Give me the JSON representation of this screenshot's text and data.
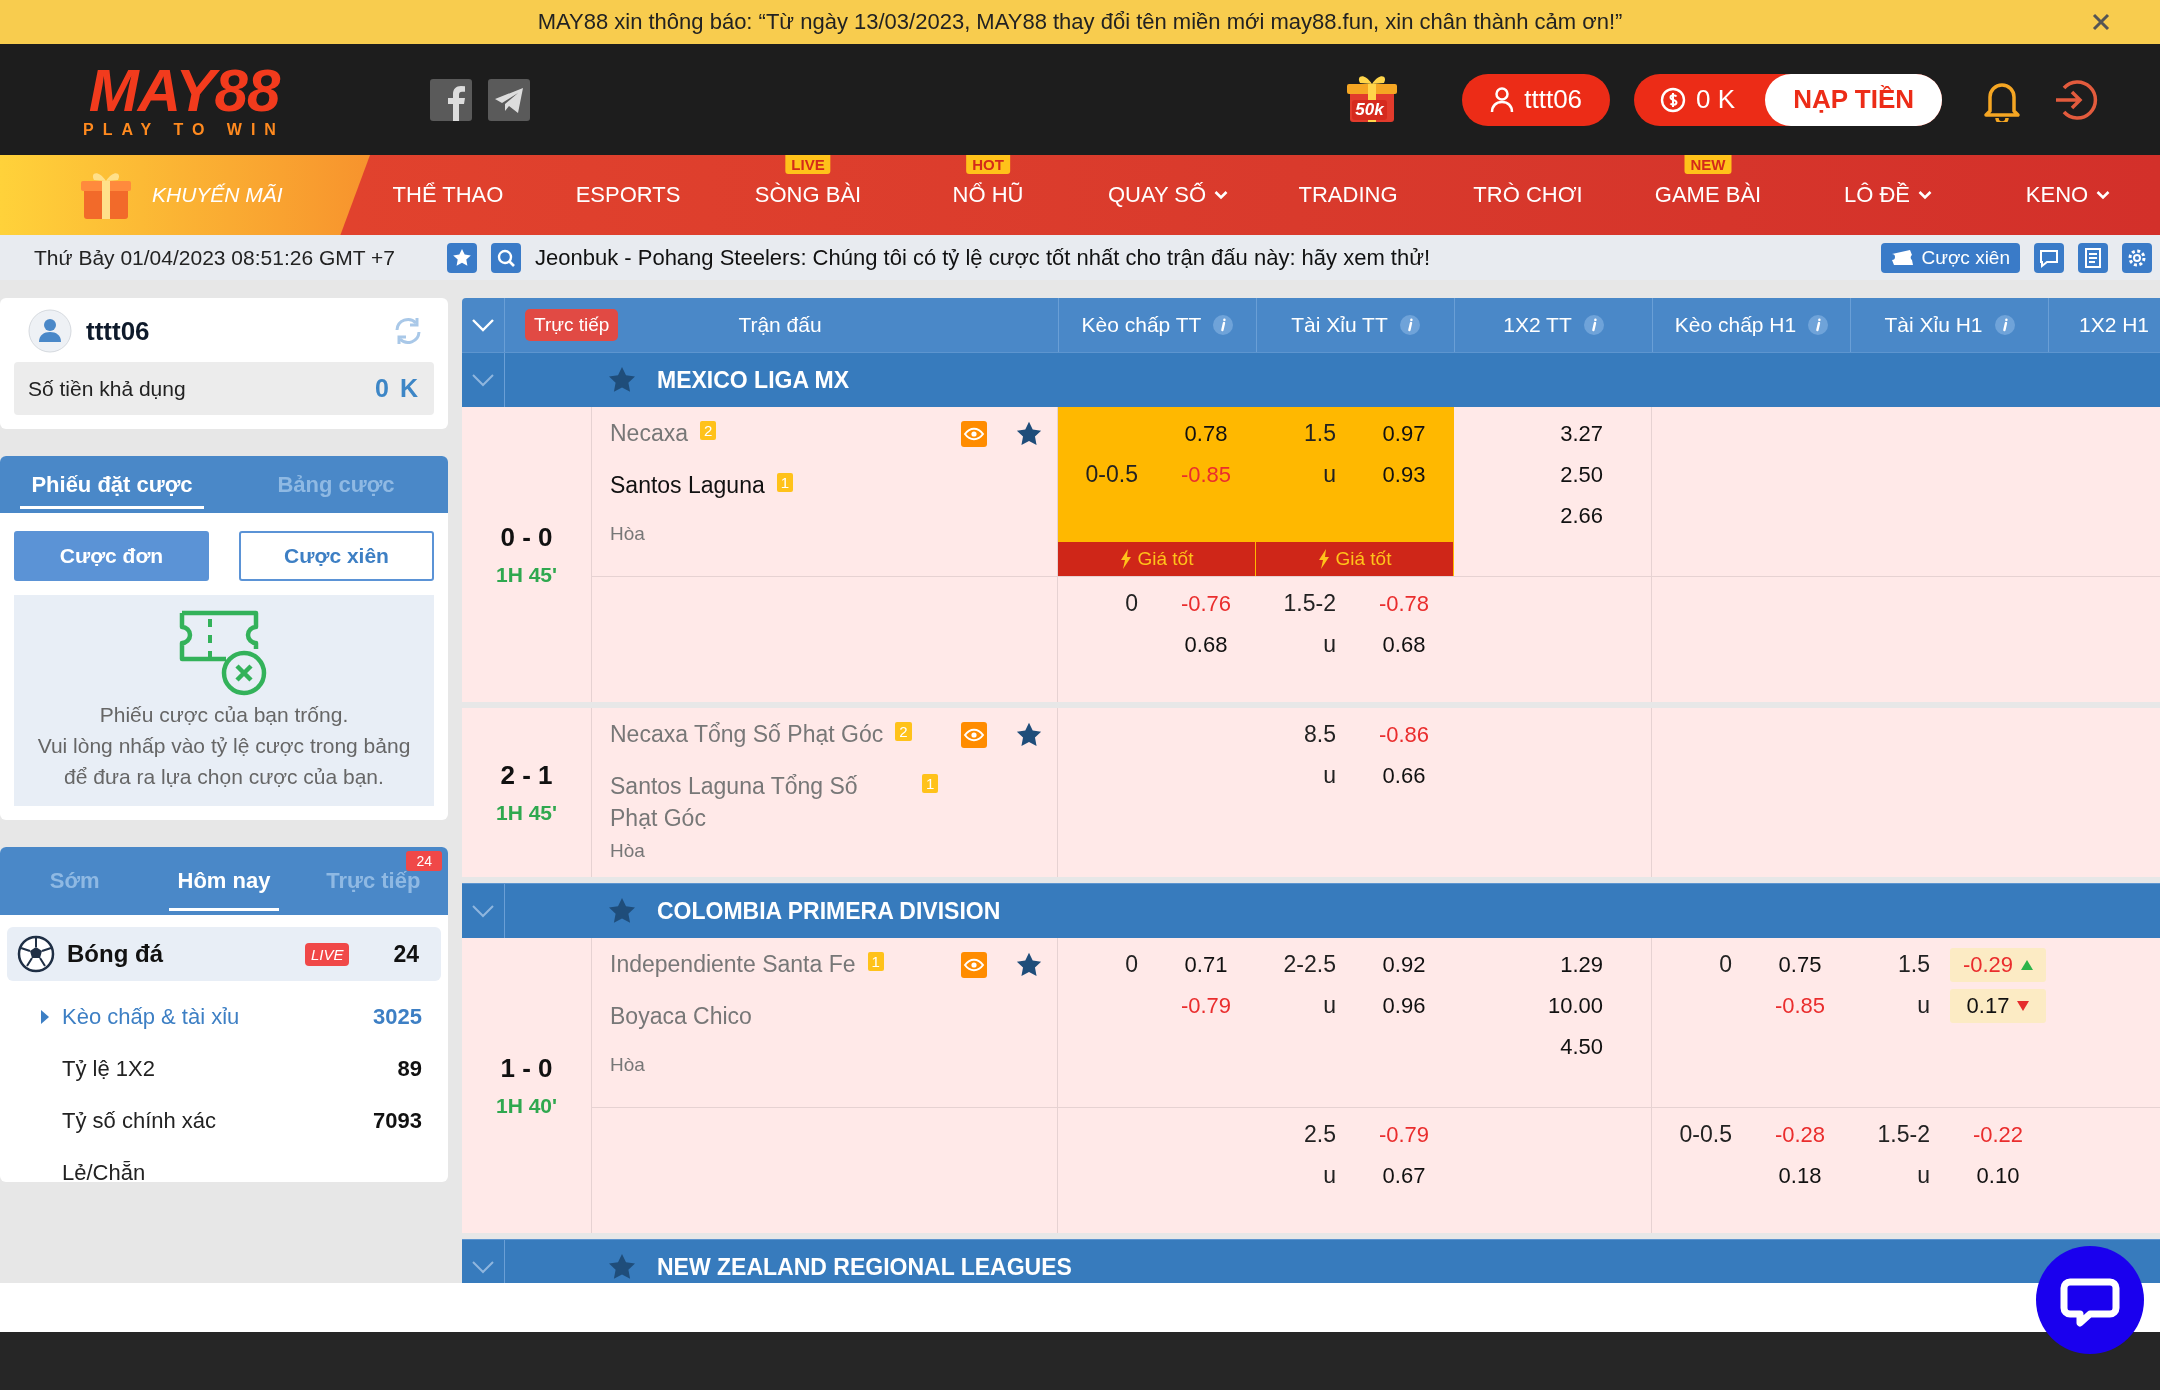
{
  "notice": {
    "text": "MAY88 xin thông báo: “Từ ngày 13/03/2023, MAY88 thay đổi tên miền mới may88.fun, xin chân thành cảm ơn!”"
  },
  "header": {
    "logo": {
      "wordmark": "MAY88",
      "tagline": "PLAY TO WIN"
    },
    "promo_label": "50k",
    "username": "tttt06",
    "balance": "0 K",
    "deposit": "NẠP TIỀN"
  },
  "nav": {
    "promo": "KHUYẾN MÃI",
    "items": [
      {
        "label": "THỂ THAO",
        "dropdown": false
      },
      {
        "label": "ESPORTS",
        "dropdown": false
      },
      {
        "label": "SÒNG BÀI",
        "tag": "LIVE",
        "dropdown": false
      },
      {
        "label": "NỔ HŨ",
        "tag": "HOT",
        "dropdown": false
      },
      {
        "label": "QUAY SỐ",
        "dropdown": true
      },
      {
        "label": "TRADING",
        "dropdown": false
      },
      {
        "label": "TRÒ CHƠI",
        "dropdown": false
      },
      {
        "label": "GAME BÀI",
        "tag": "NEW",
        "dropdown": false
      },
      {
        "label": "LÔ ĐỀ",
        "dropdown": true
      },
      {
        "label": "KENO",
        "dropdown": true
      }
    ]
  },
  "ticker": {
    "datetime": "Thứ Bảy 01/04/2023 08:51:26 GMT +7",
    "message": "Jeonbuk - Pohang Steelers: Chúng tôi có tỷ lệ cược tốt nhất cho trận đấu này: hãy xem thử!",
    "parlay_button": "Cược xiên"
  },
  "account": {
    "username": "tttt06",
    "balance_label": "Số tiền khả dụng",
    "balance": "0 K"
  },
  "bet_slip": {
    "tabs": [
      {
        "label": "Phiếu đặt cược",
        "selected": true
      },
      {
        "label": "Bảng cược",
        "selected": false
      }
    ],
    "bet_types": [
      {
        "label": "Cược đơn",
        "selected": true
      },
      {
        "label": "Cược xiên",
        "selected": false
      }
    ],
    "empty_lines": [
      "Phiếu cược của bạn trống.",
      "Vui lòng nhấp vào tỷ lệ cược trong bảng để đưa ra lựa chọn cược của bạn."
    ]
  },
  "sports": {
    "tabs": [
      {
        "label": "Sớm",
        "selected": false
      },
      {
        "label": "Hôm nay",
        "selected": true
      },
      {
        "label": "Trực tiếp",
        "selected": false,
        "badge": "24"
      }
    ],
    "sport": {
      "name": "Bóng đá",
      "live": "LIVE",
      "count": "24"
    },
    "markets": [
      {
        "label": "Kèo chấp & tài xỉu",
        "count": "3025",
        "selected": true
      },
      {
        "label": "Tỷ lệ 1X2",
        "count": "89",
        "selected": false
      },
      {
        "label": "Tỷ số chính xác",
        "count": "7093",
        "selected": false
      },
      {
        "label": "Lẻ/Chẵn",
        "selected": false
      }
    ]
  },
  "table": {
    "live_badge": "Trực tiếp",
    "match_header": "Trận đấu",
    "columns": [
      {
        "label": "Kèo chấp TT",
        "kind": "handicap",
        "info": true
      },
      {
        "label": "Tài Xỉu TT",
        "kind": "handicap",
        "info": true
      },
      {
        "label": "1X2 TT",
        "kind": "threeway",
        "info": true
      },
      {
        "label": "Kèo chấp H1",
        "kind": "handicap",
        "info": true
      },
      {
        "label": "Tài Xỉu H1",
        "kind": "handicap",
        "info": true
      },
      {
        "label": "1X2 H1",
        "kind": "threeway"
      }
    ],
    "leagues": [
      {
        "name": "MEXICO LIGA MX",
        "matches": [
          {
            "score": "0 - 0",
            "time": "1H 45'",
            "teams": [
              {
                "name": "Necaxa",
                "badge": "2",
                "highlighted": false
              },
              {
                "name": "Santos Laguna",
                "badge": "1",
                "highlighted": true
              }
            ],
            "draw": "Hòa",
            "lines": [
              {
                "cells": [
                  {
                    "best_price": "Giá tốt",
                    "rows": [
                      {
                        "odds": "0.78",
                        "negative": false
                      },
                      {
                        "line": "0-0.5",
                        "odds": "-0.85",
                        "negative": true
                      }
                    ]
                  },
                  {
                    "best_price": "Giá tốt",
                    "rows": [
                      {
                        "line": "1.5",
                        "odds": "0.97",
                        "negative": false
                      },
                      {
                        "line": "u",
                        "odds": "0.93",
                        "negative": false
                      }
                    ]
                  },
                  {
                    "rows": [
                      {
                        "odds": "3.27",
                        "negative": false
                      },
                      {
                        "odds": "2.50",
                        "negative": false
                      },
                      {
                        "odds": "2.66",
                        "negative": false
                      }
                    ]
                  }
                ]
              },
              {
                "cells": [
                  {
                    "rows": [
                      {
                        "line": "0",
                        "odds": "-0.76",
                        "negative": true
                      },
                      {
                        "odds": "0.68",
                        "negative": false
                      }
                    ]
                  },
                  {
                    "rows": [
                      {
                        "line": "1.5-2",
                        "odds": "-0.78",
                        "negative": true
                      },
                      {
                        "line": "u",
                        "odds": "0.68",
                        "negative": false
                      }
                    ]
                  }
                ]
              }
            ]
          },
          {
            "score": "2 - 1",
            "time": "1H 45'",
            "teams": [
              {
                "name": "Necaxa Tổng Số Phạt Góc",
                "badge": "2",
                "highlighted": false
              },
              {
                "name": "Santos Laguna Tổng Số Phạt Góc",
                "badge": "1",
                "highlighted": false
              }
            ],
            "draw": "Hòa",
            "lines": [
              {
                "cells": [
                  {},
                  {
                    "rows": [
                      {
                        "line": "8.5",
                        "odds": "-0.86",
                        "negative": true
                      },
                      {
                        "line": "u",
                        "odds": "0.66",
                        "negative": false
                      }
                    ]
                  }
                ]
              }
            ]
          }
        ]
      },
      {
        "name": "COLOMBIA PRIMERA DIVISION",
        "matches": [
          {
            "score": "1 - 0",
            "time": "1H 40'",
            "teams": [
              {
                "name": "Independiente Santa Fe",
                "badge": "1",
                "highlighted": false
              },
              {
                "name": "Boyaca Chico",
                "highlighted": false
              }
            ],
            "draw": "Hòa",
            "lines": [
              {
                "cells": [
                  {
                    "rows": [
                      {
                        "line": "0",
                        "odds": "0.71",
                        "negative": false
                      },
                      {
                        "odds": "-0.79",
                        "negative": true
                      }
                    ]
                  },
                  {
                    "rows": [
                      {
                        "line": "2-2.5",
                        "odds": "0.92",
                        "negative": false
                      },
                      {
                        "line": "u",
                        "odds": "0.96",
                        "negative": false
                      }
                    ]
                  },
                  {
                    "rows": [
                      {
                        "odds": "1.29",
                        "negative": false
                      },
                      {
                        "odds": "10.00",
                        "negative": false
                      },
                      {
                        "odds": "4.50",
                        "negative": false
                      }
                    ]
                  },
                  {
                    "rows": [
                      {
                        "line": "0",
                        "odds": "0.75",
                        "negative": false
                      },
                      {
                        "odds": "-0.85",
                        "negative": true
                      }
                    ]
                  },
                  {
                    "rows": [
                      {
                        "line": "1.5",
                        "odds": "-0.29",
                        "negative": true,
                        "rising": true
                      },
                      {
                        "line": "u",
                        "odds": "0.17",
                        "negative": false,
                        "rising": false
                      }
                    ]
                  }
                ]
              },
              {
                "cells": [
                  {},
                  {
                    "rows": [
                      {
                        "line": "2.5",
                        "odds": "-0.79",
                        "negative": true
                      },
                      {
                        "line": "u",
                        "odds": "0.67",
                        "negative": false
                      }
                    ]
                  },
                  {},
                  {
                    "rows": [
                      {
                        "line": "0-0.5",
                        "odds": "-0.28",
                        "negative": true
                      },
                      {
                        "odds": "0.18",
                        "negative": false
                      }
                    ]
                  },
                  {
                    "rows": [
                      {
                        "line": "1.5-2",
                        "odds": "-0.22",
                        "negative": true
                      },
                      {
                        "line": "u",
                        "odds": "0.10",
                        "negative": false
                      }
                    ]
                  }
                ]
              }
            ]
          }
        ]
      },
      {
        "name": "NEW ZEALAND REGIONAL LEAGUES"
      }
    ]
  }
}
